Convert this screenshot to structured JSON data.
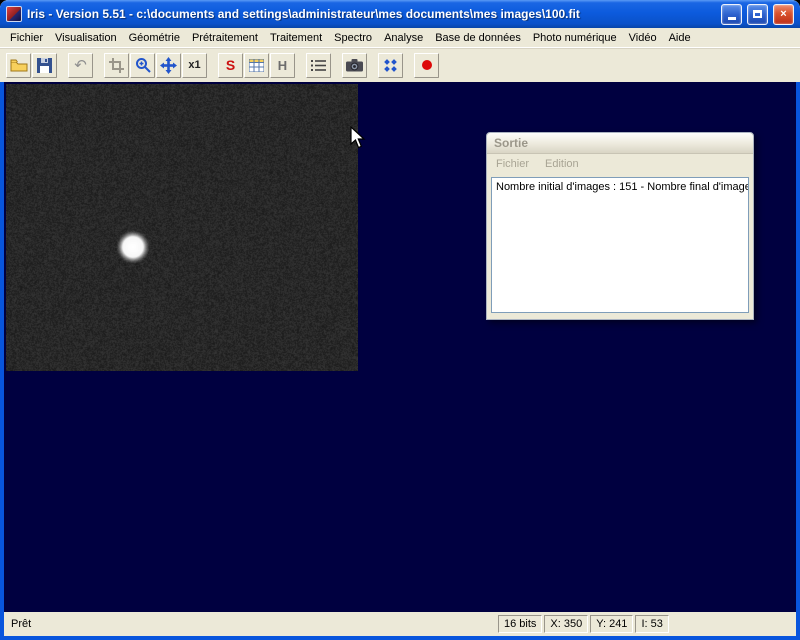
{
  "window": {
    "title": "Iris - Version 5.51 - c:\\documents and settings\\administrateur\\mes documents\\mes images\\100.fit"
  },
  "menubar": {
    "items": [
      "Fichier",
      "Visualisation",
      "Géométrie",
      "Prétraitement",
      "Traitement",
      "Spectro",
      "Analyse",
      "Base de données",
      "Photo numérique",
      "Vidéo",
      "Aide"
    ]
  },
  "toolbar": {
    "x1_label": "x1",
    "threshold_label": "S",
    "histogram_label": "H",
    "undo_glyph": "↶"
  },
  "sortie_window": {
    "title": "Sortie",
    "menu": [
      "Fichier",
      "Edition"
    ],
    "content": "Nombre initial d'images : 151  -  Nombre final d'image"
  },
  "statusbar": {
    "ready": "Prêt",
    "panels": [
      "16 bits",
      "X: 350",
      "Y: 241",
      "I: 53"
    ]
  },
  "colors": {
    "workspace": "#000040",
    "titlebar_blue": "#0C5BDD",
    "chrome": "#ECE9D8",
    "close_red": "#BC2E18"
  }
}
